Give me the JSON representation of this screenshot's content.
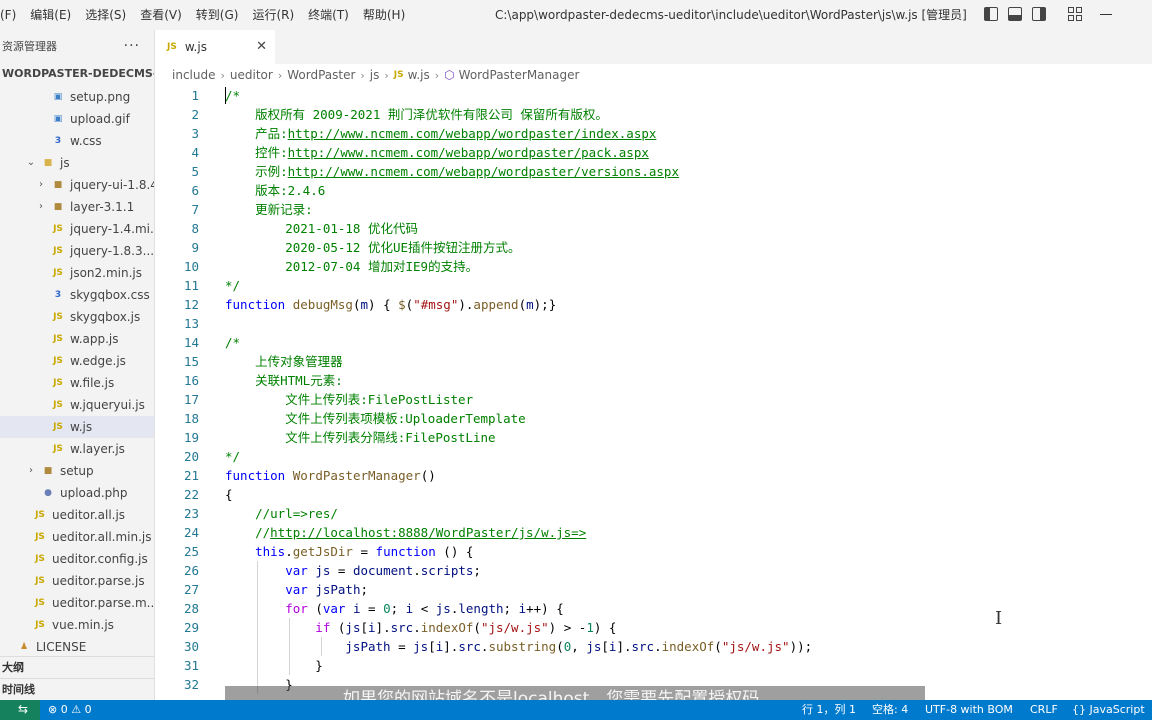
{
  "menu": [
    "(F)",
    "编辑(E)",
    "选择(S)",
    "查看(V)",
    "转到(G)",
    "运行(R)",
    "终端(T)",
    "帮助(H)"
  ],
  "window_title": "C:\\app\\wordpaster-dedecms-ueditor\\include\\ueditor\\WordPaster\\js\\w.js [管理员]",
  "sidebar": {
    "title": "资源管理器",
    "more": "···",
    "root": "WORDPASTER-DEDECMS-U...",
    "items": [
      {
        "name": "setup.png",
        "type": "image",
        "indent": 3,
        "chevron": ""
      },
      {
        "name": "upload.gif",
        "type": "image",
        "indent": 3,
        "chevron": ""
      },
      {
        "name": "w.css",
        "type": "css",
        "indent": 3,
        "chevron": ""
      },
      {
        "name": "js",
        "type": "folder-open",
        "indent": 2,
        "chevron": "⌄"
      },
      {
        "name": "jquery-ui-1.8.4",
        "type": "folder",
        "indent": 3,
        "chevron": "›"
      },
      {
        "name": "layer-3.1.1",
        "type": "folder",
        "indent": 3,
        "chevron": "›"
      },
      {
        "name": "jquery-1.4.mi...",
        "type": "js",
        "indent": 3,
        "chevron": ""
      },
      {
        "name": "jquery-1.8.3....",
        "type": "js",
        "indent": 3,
        "chevron": ""
      },
      {
        "name": "json2.min.js",
        "type": "js",
        "indent": 3,
        "chevron": ""
      },
      {
        "name": "skygqbox.css",
        "type": "css",
        "indent": 3,
        "chevron": ""
      },
      {
        "name": "skygqbox.js",
        "type": "js",
        "indent": 3,
        "chevron": ""
      },
      {
        "name": "w.app.js",
        "type": "js",
        "indent": 3,
        "chevron": ""
      },
      {
        "name": "w.edge.js",
        "type": "js",
        "indent": 3,
        "chevron": ""
      },
      {
        "name": "w.file.js",
        "type": "js",
        "indent": 3,
        "chevron": ""
      },
      {
        "name": "w.jqueryui.js",
        "type": "js",
        "indent": 3,
        "chevron": ""
      },
      {
        "name": "w.js",
        "type": "js",
        "indent": 3,
        "chevron": "",
        "selected": true
      },
      {
        "name": "w.layer.js",
        "type": "js",
        "indent": 3,
        "chevron": ""
      },
      {
        "name": "setup",
        "type": "folder",
        "indent": 2,
        "chevron": "›"
      },
      {
        "name": "upload.php",
        "type": "php",
        "indent": 2,
        "chevron": ""
      },
      {
        "name": "ueditor.all.js",
        "type": "js",
        "indent": 1,
        "chevron": ""
      },
      {
        "name": "ueditor.all.min.js",
        "type": "js",
        "indent": 1,
        "chevron": ""
      },
      {
        "name": "ueditor.config.js",
        "type": "js",
        "indent": 1,
        "chevron": ""
      },
      {
        "name": "ueditor.parse.js",
        "type": "js",
        "indent": 1,
        "chevron": ""
      },
      {
        "name": "ueditor.parse.m...",
        "type": "js",
        "indent": 1,
        "chevron": ""
      },
      {
        "name": "vue.min.js",
        "type": "js",
        "indent": 1,
        "chevron": ""
      },
      {
        "name": "LICENSE",
        "type": "license",
        "indent": 0,
        "chevron": ""
      }
    ],
    "outline": "大纲",
    "timeline": "时间线"
  },
  "tab": {
    "icon": "JS",
    "label": "w.js",
    "close": "✕"
  },
  "breadcrumb": [
    "include",
    "ueditor",
    "WordPaster",
    "js",
    "w.js",
    "WordPasterManager"
  ],
  "breadcrumb_js_icon": "JS",
  "breadcrumb_symbol_icon": "⬡",
  "code_lines": [
    {
      "n": 1,
      "indent": 0,
      "tokens": [
        [
          "c",
          "/*"
        ]
      ]
    },
    {
      "n": 2,
      "indent": 0,
      "tokens": [
        [
          "c",
          "    版权所有 2009-2021 荆门泽优软件有限公司 保留所有版权。"
        ]
      ]
    },
    {
      "n": 3,
      "indent": 0,
      "tokens": [
        [
          "c",
          "    产品:"
        ],
        [
          "lnk",
          "http://www.ncmem.com/webapp/wordpaster/index.aspx"
        ]
      ]
    },
    {
      "n": 4,
      "indent": 0,
      "tokens": [
        [
          "c",
          "    控件:"
        ],
        [
          "lnk",
          "http://www.ncmem.com/webapp/wordpaster/pack.aspx"
        ]
      ]
    },
    {
      "n": 5,
      "indent": 0,
      "tokens": [
        [
          "c",
          "    示例:"
        ],
        [
          "lnk",
          "http://www.ncmem.com/webapp/wordpaster/versions.aspx"
        ]
      ]
    },
    {
      "n": 6,
      "indent": 0,
      "tokens": [
        [
          "c",
          "    版本:2.4.6"
        ]
      ]
    },
    {
      "n": 7,
      "indent": 0,
      "tokens": [
        [
          "c",
          "    更新记录:"
        ]
      ]
    },
    {
      "n": 8,
      "indent": 0,
      "tokens": [
        [
          "c",
          "        2021-01-18 优化代码"
        ]
      ]
    },
    {
      "n": 9,
      "indent": 0,
      "tokens": [
        [
          "c",
          "        2020-05-12 优化UE插件按钮注册方式。"
        ]
      ]
    },
    {
      "n": 10,
      "indent": 0,
      "tokens": [
        [
          "c",
          "        2012-07-04 增加对IE9的支持。"
        ]
      ]
    },
    {
      "n": 11,
      "indent": 0,
      "tokens": [
        [
          "c",
          "*/"
        ]
      ]
    },
    {
      "n": 12,
      "indent": 0,
      "tokens": [
        [
          "k",
          "function"
        ],
        [
          "p",
          " "
        ],
        [
          "f",
          "debugMsg"
        ],
        [
          "p",
          "("
        ],
        [
          "v",
          "m"
        ],
        [
          "p",
          ") { "
        ],
        [
          "f",
          "$"
        ],
        [
          "p",
          "("
        ],
        [
          "s",
          "\"#msg\""
        ],
        [
          "p",
          ")."
        ],
        [
          "f",
          "append"
        ],
        [
          "p",
          "("
        ],
        [
          "v",
          "m"
        ],
        [
          "p",
          ");}"
        ]
      ]
    },
    {
      "n": 13,
      "indent": 0,
      "tokens": []
    },
    {
      "n": 14,
      "indent": 0,
      "tokens": [
        [
          "c",
          "/*"
        ]
      ]
    },
    {
      "n": 15,
      "indent": 0,
      "tokens": [
        [
          "c",
          "    上传对象管理器"
        ]
      ]
    },
    {
      "n": 16,
      "indent": 0,
      "tokens": [
        [
          "c",
          "    关联HTML元素:"
        ]
      ]
    },
    {
      "n": 17,
      "indent": 0,
      "tokens": [
        [
          "c",
          "        文件上传列表:FilePostLister"
        ]
      ]
    },
    {
      "n": 18,
      "indent": 0,
      "tokens": [
        [
          "c",
          "        文件上传列表项模板:UploaderTemplate"
        ]
      ]
    },
    {
      "n": 19,
      "indent": 0,
      "tokens": [
        [
          "c",
          "        文件上传列表分隔线:FilePostLine"
        ]
      ]
    },
    {
      "n": 20,
      "indent": 0,
      "tokens": [
        [
          "c",
          "*/"
        ]
      ]
    },
    {
      "n": 21,
      "indent": 0,
      "tokens": [
        [
          "k",
          "function"
        ],
        [
          "p",
          " "
        ],
        [
          "f",
          "WordPasterManager"
        ],
        [
          "p",
          "()"
        ]
      ]
    },
    {
      "n": 22,
      "indent": 0,
      "tokens": [
        [
          "p",
          "{"
        ]
      ]
    },
    {
      "n": 23,
      "indent": 1,
      "tokens": [
        [
          "c",
          "    //url=>res/"
        ]
      ]
    },
    {
      "n": 24,
      "indent": 1,
      "tokens": [
        [
          "c",
          "    //"
        ],
        [
          "lnk",
          "http://localhost:8888/WordPaster/js/w.js=>"
        ]
      ]
    },
    {
      "n": 25,
      "indent": 1,
      "tokens": [
        [
          "k",
          "    this"
        ],
        [
          "p",
          "."
        ],
        [
          "f",
          "getJsDir"
        ],
        [
          "p",
          " = "
        ],
        [
          "k",
          "function"
        ],
        [
          "p",
          " () {"
        ]
      ]
    },
    {
      "n": 26,
      "indent": 2,
      "tokens": [
        [
          "k",
          "        var"
        ],
        [
          "p",
          " "
        ],
        [
          "v",
          "js"
        ],
        [
          "p",
          " = "
        ],
        [
          "v",
          "document"
        ],
        [
          "p",
          "."
        ],
        [
          "v",
          "scripts"
        ],
        [
          "p",
          ";"
        ]
      ]
    },
    {
      "n": 27,
      "indent": 2,
      "tokens": [
        [
          "k",
          "        var"
        ],
        [
          "p",
          " "
        ],
        [
          "v",
          "jsPath"
        ],
        [
          "p",
          ";"
        ]
      ]
    },
    {
      "n": 28,
      "indent": 2,
      "tokens": [
        [
          "ctl",
          "        for"
        ],
        [
          "p",
          " ("
        ],
        [
          "k",
          "var"
        ],
        [
          "p",
          " "
        ],
        [
          "v",
          "i"
        ],
        [
          "p",
          " = "
        ],
        [
          "n",
          "0"
        ],
        [
          "p",
          "; "
        ],
        [
          "v",
          "i"
        ],
        [
          "p",
          " < "
        ],
        [
          "v",
          "js"
        ],
        [
          "p",
          "."
        ],
        [
          "v",
          "length"
        ],
        [
          "p",
          "; "
        ],
        [
          "v",
          "i"
        ],
        [
          "p",
          "++) {"
        ]
      ]
    },
    {
      "n": 29,
      "indent": 3,
      "tokens": [
        [
          "ctl",
          "            if"
        ],
        [
          "p",
          " ("
        ],
        [
          "v",
          "js"
        ],
        [
          "p",
          "["
        ],
        [
          "v",
          "i"
        ],
        [
          "p",
          "]."
        ],
        [
          "v",
          "src"
        ],
        [
          "p",
          "."
        ],
        [
          "f",
          "indexOf"
        ],
        [
          "p",
          "("
        ],
        [
          "s",
          "\"js/w.js\""
        ],
        [
          "p",
          ") > -"
        ],
        [
          "n",
          "1"
        ],
        [
          "p",
          ") {"
        ]
      ]
    },
    {
      "n": 30,
      "indent": 4,
      "tokens": [
        [
          "v",
          "                jsPath"
        ],
        [
          "p",
          " = "
        ],
        [
          "v",
          "js"
        ],
        [
          "p",
          "["
        ],
        [
          "v",
          "i"
        ],
        [
          "p",
          "]."
        ],
        [
          "v",
          "src"
        ],
        [
          "p",
          "."
        ],
        [
          "f",
          "substring"
        ],
        [
          "p",
          "("
        ],
        [
          "n",
          "0"
        ],
        [
          "p",
          ", "
        ],
        [
          "v",
          "js"
        ],
        [
          "p",
          "["
        ],
        [
          "v",
          "i"
        ],
        [
          "p",
          "]."
        ],
        [
          "v",
          "src"
        ],
        [
          "p",
          "."
        ],
        [
          "f",
          "indexOf"
        ],
        [
          "p",
          "("
        ],
        [
          "s",
          "\"js/w.js\""
        ],
        [
          "p",
          "));"
        ]
      ]
    },
    {
      "n": 31,
      "indent": 3,
      "tokens": [
        [
          "p",
          "            }"
        ]
      ]
    },
    {
      "n": 32,
      "indent": 2,
      "tokens": [
        [
          "p",
          "        }"
        ]
      ]
    }
  ],
  "subtitle": "如果您的网站域名不是localhost，您需要先配置授权码",
  "status": {
    "errors": "⊗ 0 ⚠ 0",
    "position": "行 1，列 1",
    "spaces": "空格: 4",
    "encoding": "UTF-8 with BOM",
    "eol": "CRLF",
    "language": "{} JavaScript"
  }
}
